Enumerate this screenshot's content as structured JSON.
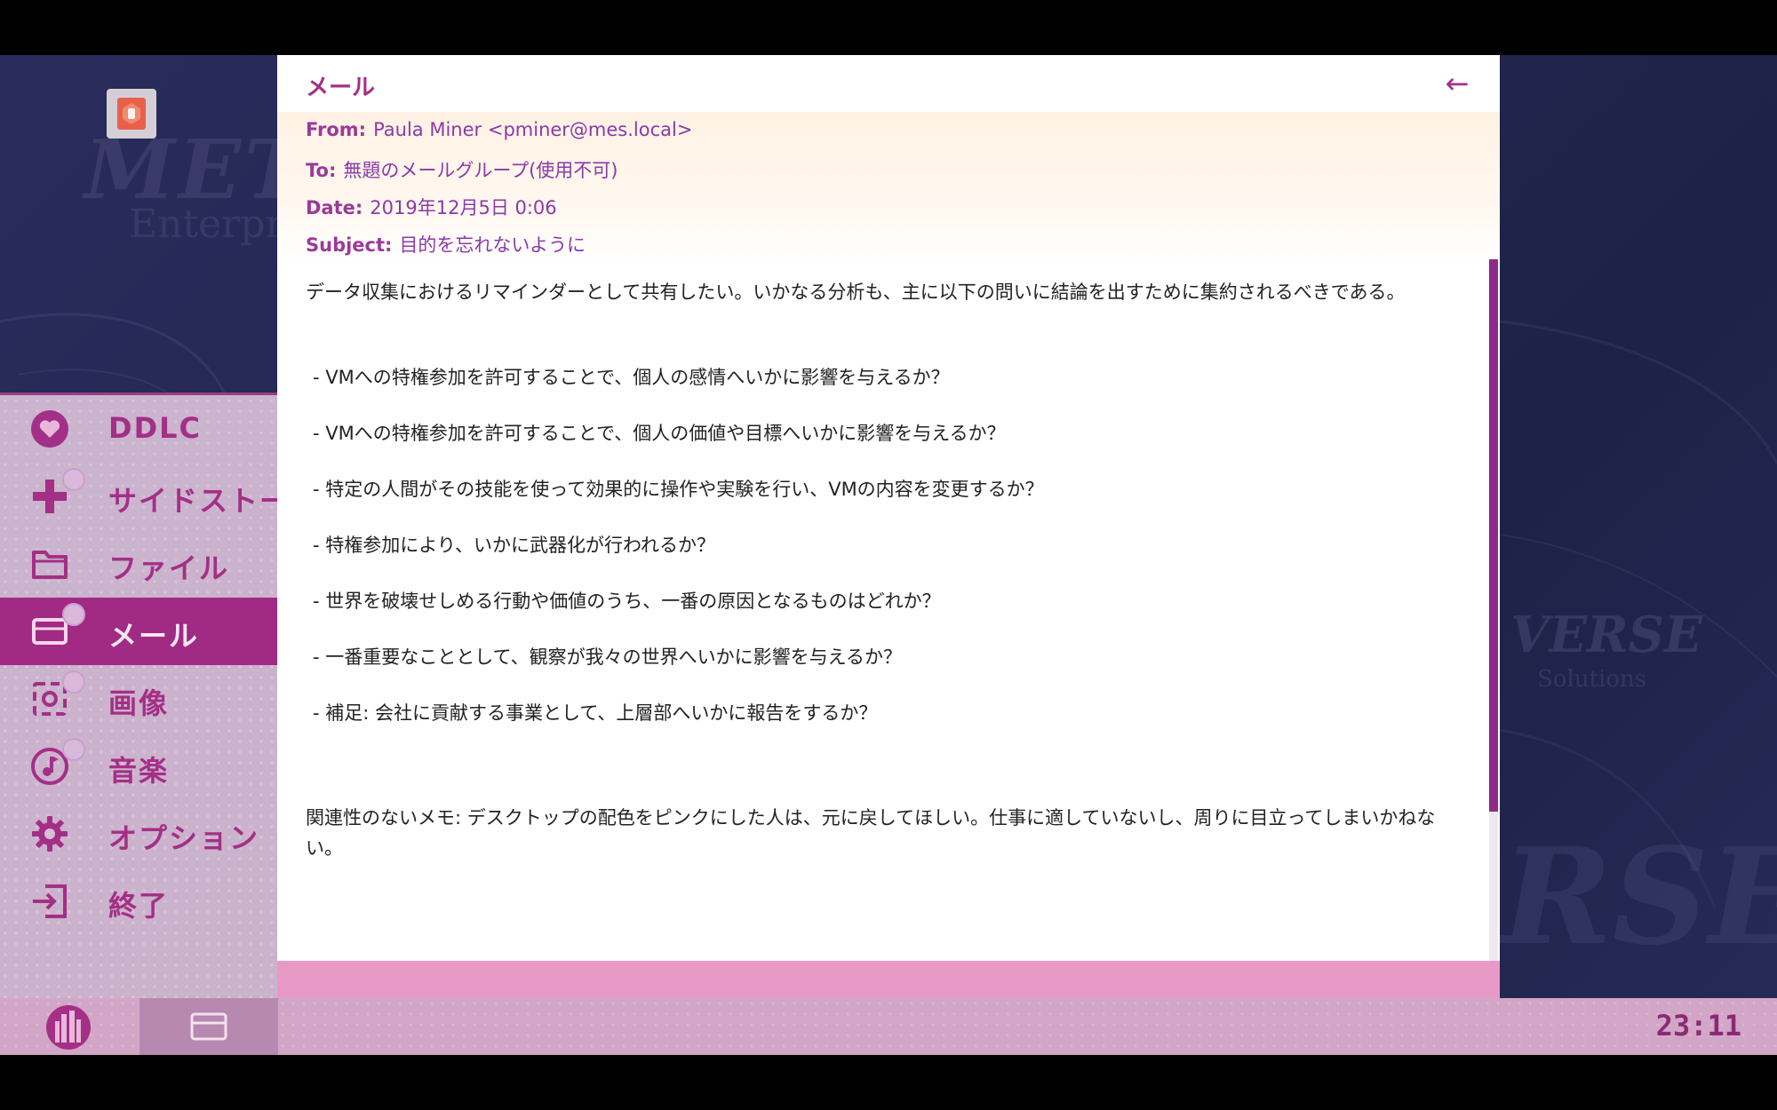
{
  "window": {
    "title": "メール",
    "back_label": "←"
  },
  "email": {
    "from_key": "From:",
    "from": "Paula Miner <pminer@mes.local>",
    "to_key": "To:",
    "to": "無題のメールグループ(使用不可)",
    "date_key": "Date:",
    "date": "2019年12月5日 0:06",
    "subject_key": "Subject:",
    "subject": "目的を忘れないように",
    "intro": "データ収集におけるリマインダーとして共有したい。いかなる分析も、主に以下の問いに結論を出すために集約されるべきである。",
    "bullets": [
      "- VMへの特権参加を許可することで、個人の感情へいかに影響を与えるか？",
      "- VMへの特権参加を許可することで、個人の価値や目標へいかに影響を与えるか？",
      "- 特定の人間がその技能を使って効果的に操作や実験を行い、VMの内容を変更するか？",
      "- 特権参加により、いかに武器化が行われるか？",
      "- 世界を破壊せしめる行動や価値のうち、一番の原因となるものはどれか？",
      "- 一番重要なこととして、観察が我々の世界へいかに影響を与えるか？",
      "- 補足: 会社に貢献する事業として、上層部へいかに報告をするか？"
    ],
    "note": "関連性のないメモ: デスクトップの配色をピンクにした人は、元に戻してほしい。仕事に適していないし、周りに目立ってしまいかねない。"
  },
  "sidebar": {
    "items": [
      {
        "label": "DDLC",
        "icon": "heart-icon",
        "notification": false,
        "active": false
      },
      {
        "label": "サイドストーリー",
        "icon": "plus-icon",
        "notification": true,
        "active": false
      },
      {
        "label": "ファイル",
        "icon": "folder-icon",
        "notification": false,
        "active": false
      },
      {
        "label": "メール",
        "icon": "mail-icon",
        "notification": true,
        "active": true
      },
      {
        "label": "画像",
        "icon": "camera-icon",
        "notification": true,
        "active": false
      },
      {
        "label": "音楽",
        "icon": "music-icon",
        "notification": true,
        "active": false
      },
      {
        "label": "オプション",
        "icon": "gear-icon",
        "notification": false,
        "active": false
      },
      {
        "label": "終了",
        "icon": "exit-icon",
        "notification": false,
        "active": false
      }
    ]
  },
  "desktop": {
    "watermark_left": "META",
    "watermark_left_sub": "Enterpr",
    "watermark_right": "VERSE",
    "watermark_right_sub": "Solutions",
    "watermark_right_huge": "RSE"
  },
  "taskbar": {
    "clock": "23:11"
  },
  "colors": {
    "accent": "#a42f86",
    "sidebar_bg": "#d8bed6",
    "footer_pink": "#e89ac6",
    "header_text": "#8a3aa8"
  }
}
